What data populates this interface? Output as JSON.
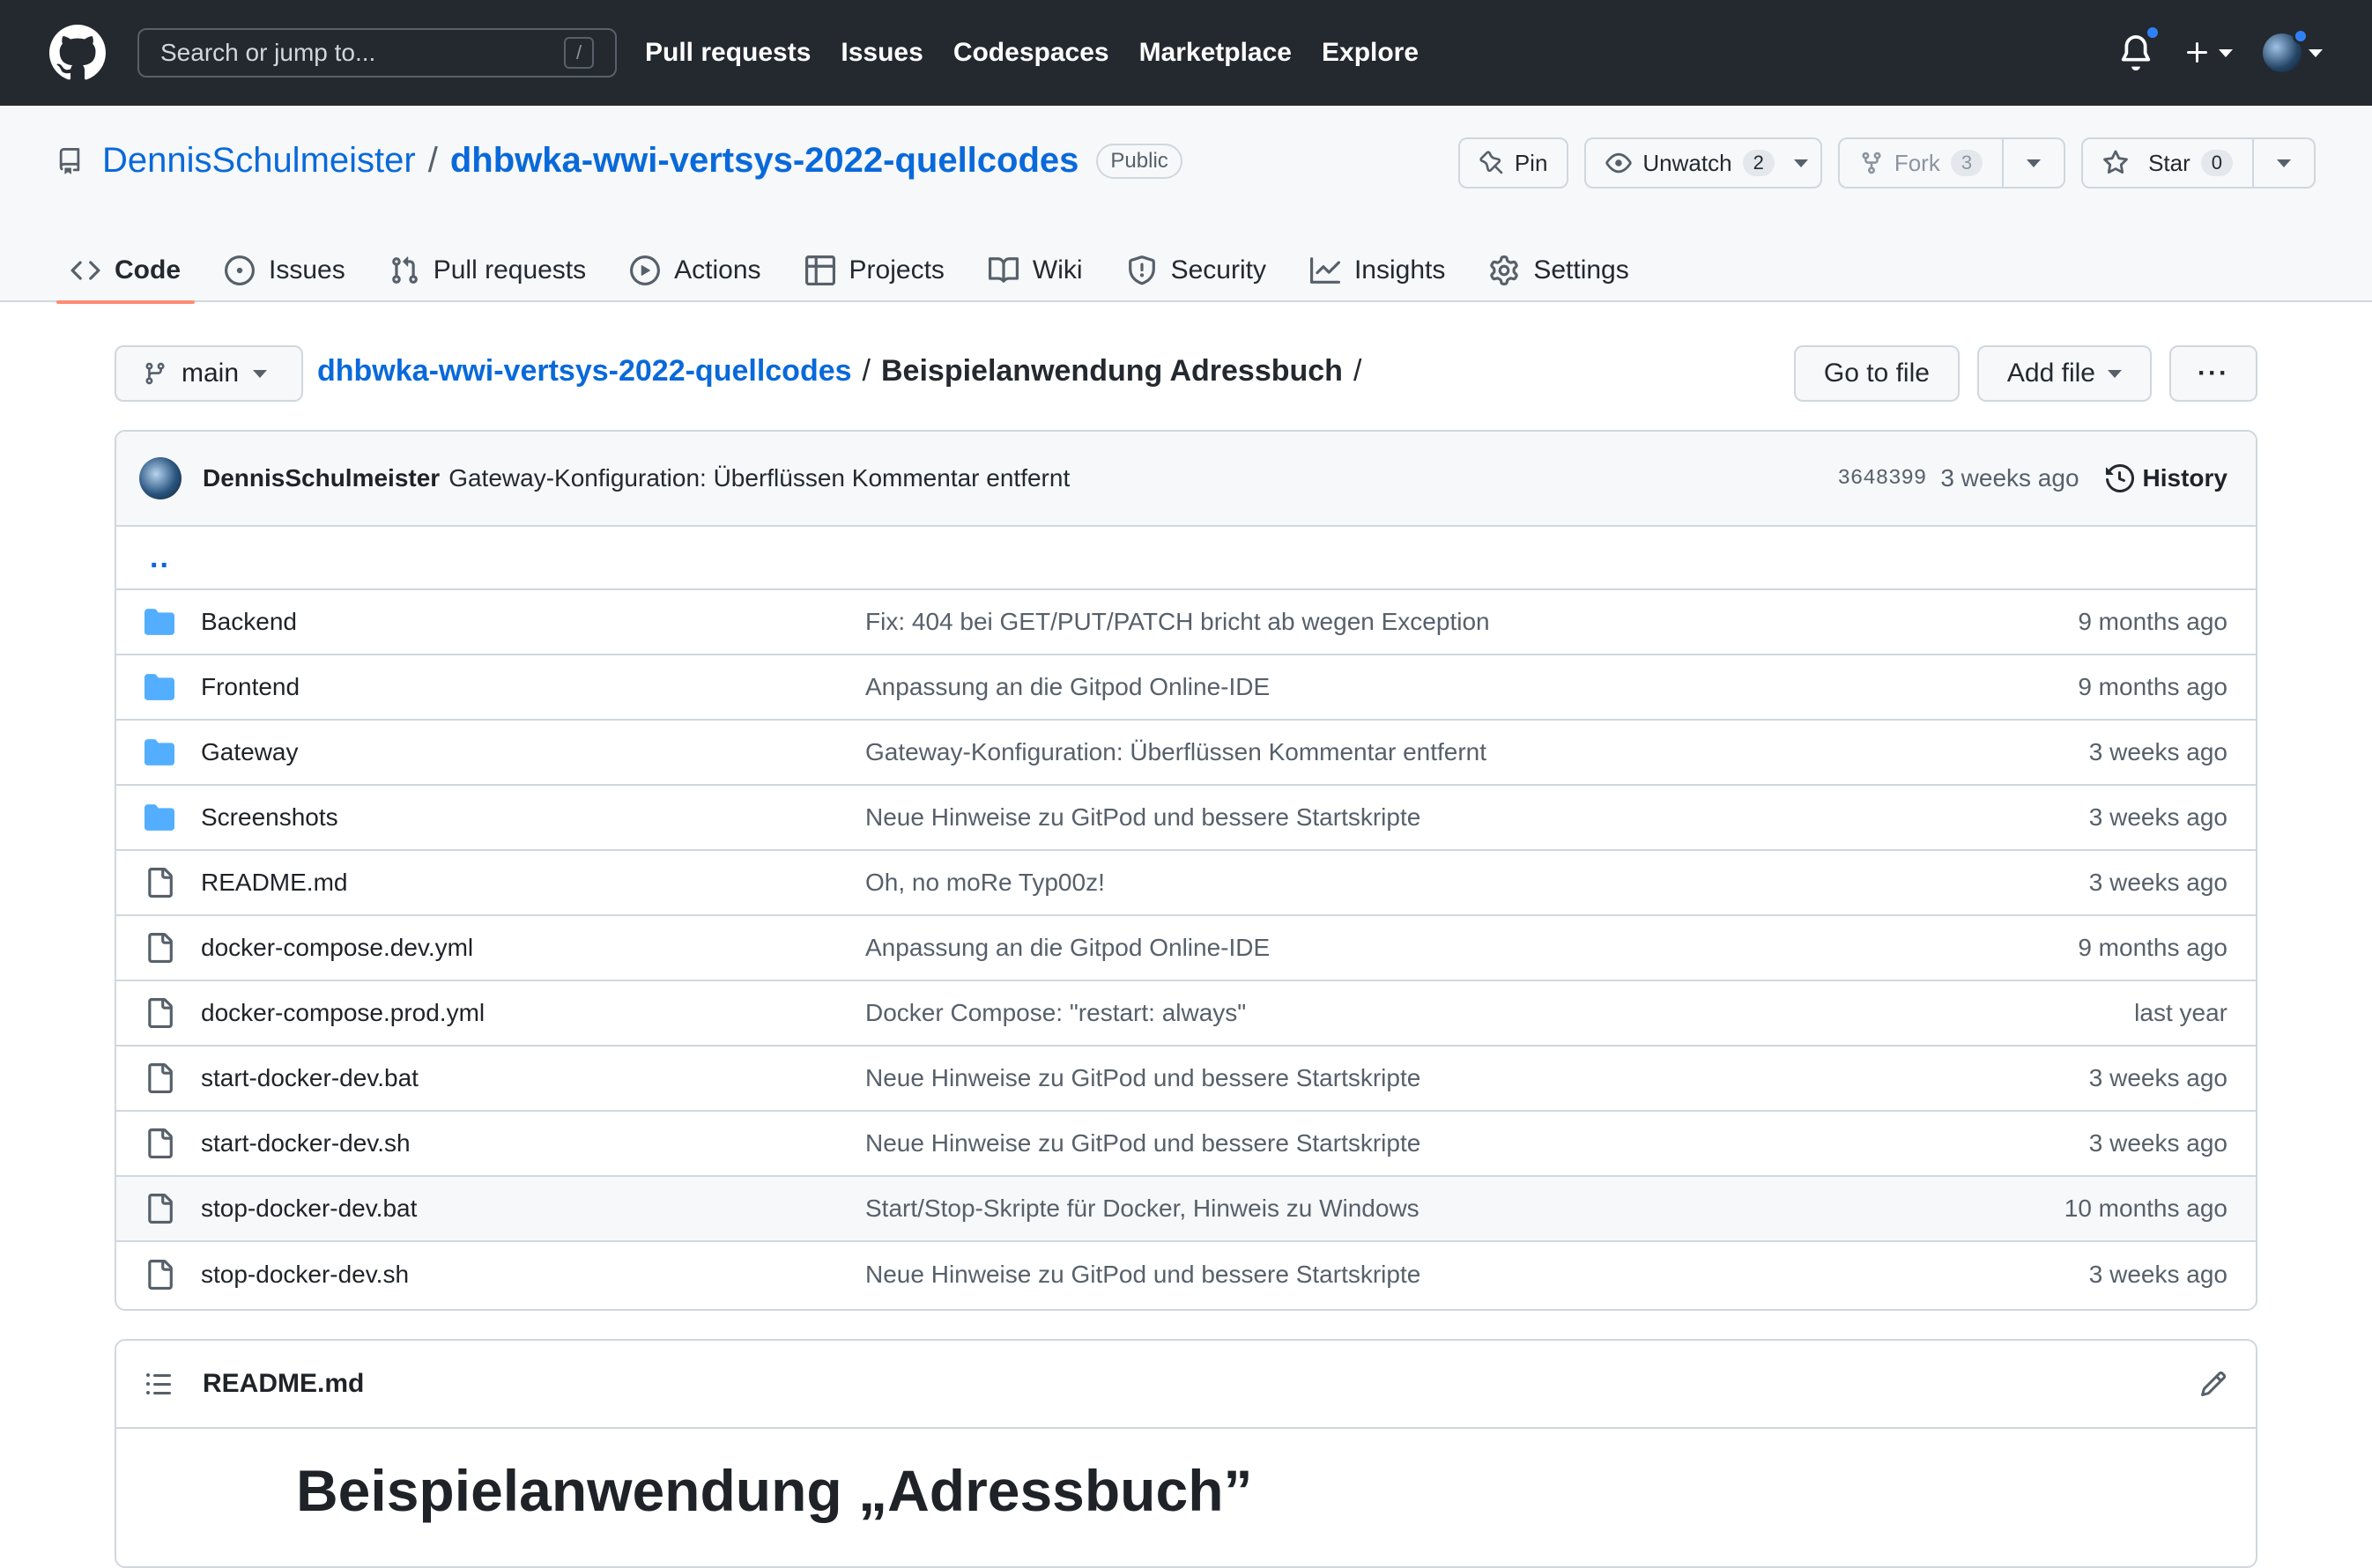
{
  "topnav": {
    "search_placeholder": "Search or jump to...",
    "search_shortcut": "/",
    "links": [
      "Pull requests",
      "Issues",
      "Codespaces",
      "Marketplace",
      "Explore"
    ]
  },
  "repo": {
    "owner": "DennisSchulmeister",
    "separator": "/",
    "name": "dhbwka-wwi-vertsys-2022-quellcodes",
    "visibility": "Public",
    "pin_label": "Pin",
    "unwatch_label": "Unwatch",
    "watch_count": "2",
    "fork_label": "Fork",
    "fork_count": "3",
    "star_label": "Star",
    "star_count": "0"
  },
  "tabs": [
    {
      "label": "Code",
      "icon": "code-icon",
      "active": true
    },
    {
      "label": "Issues",
      "icon": "issue-icon"
    },
    {
      "label": "Pull requests",
      "icon": "pull-request-icon"
    },
    {
      "label": "Actions",
      "icon": "play-icon"
    },
    {
      "label": "Projects",
      "icon": "table-icon"
    },
    {
      "label": "Wiki",
      "icon": "book-icon"
    },
    {
      "label": "Security",
      "icon": "shield-icon"
    },
    {
      "label": "Insights",
      "icon": "graph-icon"
    },
    {
      "label": "Settings",
      "icon": "gear-icon"
    }
  ],
  "path": {
    "branch": "main",
    "repo_link": "dhbwka-wwi-vertsys-2022-quellcodes",
    "separator": "/",
    "directory": "Beispielanwendung Adressbuch",
    "trailing": "/",
    "go_to_file": "Go to file",
    "add_file": "Add file",
    "more": "···"
  },
  "commit": {
    "author": "DennisSchulmeister",
    "message": "Gateway-Konfiguration: Überflüssen Kommentar entfernt",
    "sha": "3648399",
    "time": "3 weeks ago",
    "history_label": "History"
  },
  "parent_dir": "..",
  "files": [
    {
      "type": "dir",
      "name": "Backend",
      "message": "Fix: 404 bei GET/PUT/PATCH bricht ab wegen Exception",
      "time": "9 months ago"
    },
    {
      "type": "dir",
      "name": "Frontend",
      "message": "Anpassung an die Gitpod Online-IDE",
      "time": "9 months ago"
    },
    {
      "type": "dir",
      "name": "Gateway",
      "message": "Gateway-Konfiguration: Überflüssen Kommentar entfernt",
      "time": "3 weeks ago"
    },
    {
      "type": "dir",
      "name": "Screenshots",
      "message": "Neue Hinweise zu GitPod und bessere Startskripte",
      "time": "3 weeks ago"
    },
    {
      "type": "file",
      "name": "README.md",
      "message": "Oh, no moRe Typ00z!",
      "time": "3 weeks ago"
    },
    {
      "type": "file",
      "name": "docker-compose.dev.yml",
      "message": "Anpassung an die Gitpod Online-IDE",
      "time": "9 months ago"
    },
    {
      "type": "file",
      "name": "docker-compose.prod.yml",
      "message": "Docker Compose: \"restart: always\"",
      "time": "last year"
    },
    {
      "type": "file",
      "name": "start-docker-dev.bat",
      "message": "Neue Hinweise zu GitPod und bessere Startskripte",
      "time": "3 weeks ago"
    },
    {
      "type": "file",
      "name": "start-docker-dev.sh",
      "message": "Neue Hinweise zu GitPod und bessere Startskripte",
      "time": "3 weeks ago"
    },
    {
      "type": "file",
      "name": "stop-docker-dev.bat",
      "message": "Start/Stop-Skripte für Docker, Hinweis zu Windows",
      "time": "10 months ago"
    },
    {
      "type": "file",
      "name": "stop-docker-dev.sh",
      "message": "Neue Hinweise zu GitPod und bessere Startskripte",
      "time": "3 weeks ago"
    }
  ],
  "readme": {
    "filename": "README.md",
    "heading": "Beispielanwendung „Adressbuch”"
  },
  "colors": {
    "accent": "#0969da",
    "folder": "#54aeff",
    "tab_underline": "#fd8c73",
    "topbar": "#24292f"
  }
}
